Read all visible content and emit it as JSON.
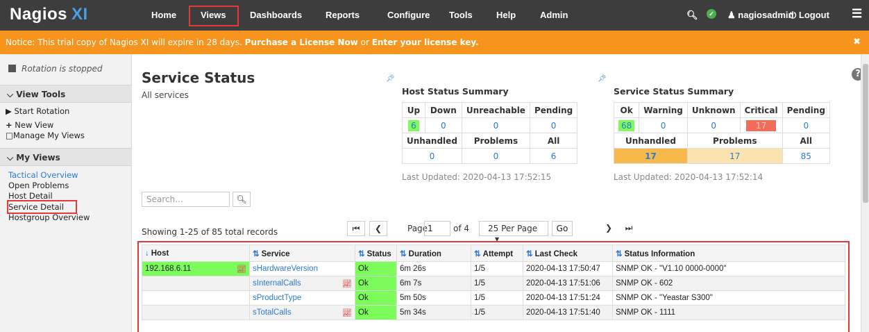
{
  "header": {
    "logo_main": "Nagios",
    "logo_sub": "XI",
    "nav": [
      "Home",
      "Views",
      "Dashboards",
      "Reports",
      "Configure",
      "Tools",
      "Help",
      "Admin"
    ],
    "user": "nagiosadmin",
    "logout": "Logout"
  },
  "notice": {
    "text": "Notice: This trial copy of Nagios XI will expire in 28 days.",
    "link1": "Purchase a License Now",
    "or": "or",
    "link2": "Enter your license key."
  },
  "sidebar": {
    "rotation": "Rotation is stopped",
    "view_tools": "View Tools",
    "start_rotation": "Start Rotation",
    "new_view": "New View",
    "manage_views": "Manage My Views",
    "my_views": "My Views",
    "views": [
      "Tactical Overview",
      "Open Problems",
      "Host Detail",
      "Service Detail",
      "Hostgroup Overview"
    ]
  },
  "main": {
    "title": "Service Status",
    "subtitle": "All services",
    "search_placeholder": "Search...",
    "showing": "Showing 1-25 of 85 total records",
    "page_label": "Page",
    "page_value": "1",
    "page_of": "of 4",
    "per_page": "25 Per Page",
    "go": "Go"
  },
  "host_summary": {
    "title": "Host Status Summary",
    "headers": [
      "Up",
      "Down",
      "Unreachable",
      "Pending"
    ],
    "values": [
      "6",
      "0",
      "0",
      "0"
    ],
    "headers2": [
      "Unhandled",
      "Problems",
      "All"
    ],
    "values2": [
      "0",
      "0",
      "6"
    ],
    "updated": "Last Updated: 2020-04-13 17:52:15"
  },
  "service_summary": {
    "title": "Service Status Summary",
    "headers": [
      "Ok",
      "Warning",
      "Unknown",
      "Critical",
      "Pending"
    ],
    "values": [
      "68",
      "0",
      "0",
      "17",
      "0"
    ],
    "headers2": [
      "Unhandled",
      "Problems",
      "All"
    ],
    "values2": [
      "17",
      "17",
      "85"
    ],
    "updated": "Last Updated: 2020-04-13 17:52:14"
  },
  "table": {
    "columns": [
      "Host",
      "Service",
      "Status",
      "Duration",
      "Attempt",
      "Last Check",
      "Status Information"
    ],
    "rows": [
      {
        "host": "192.168.6.11",
        "service": "sHardwareVersion",
        "status": "Ok",
        "duration": "6m 26s",
        "attempt": "1/5",
        "last_check": "2020-04-13 17:50:47",
        "info": "SNMP OK - \"V1.10 0000-0000\""
      },
      {
        "host": "",
        "service": "sInternalCalls",
        "status": "Ok",
        "duration": "6m 7s",
        "attempt": "1/5",
        "last_check": "2020-04-13 17:51:06",
        "info": "SNMP OK - 602"
      },
      {
        "host": "",
        "service": "sProductType",
        "status": "Ok",
        "duration": "5m 50s",
        "attempt": "1/5",
        "last_check": "2020-04-13 17:51:24",
        "info": "SNMP OK - \"Yeastar S300\""
      },
      {
        "host": "",
        "service": "sTotalCalls",
        "status": "Ok",
        "duration": "5m 34s",
        "attempt": "1/5",
        "last_check": "2020-04-13 17:51:40",
        "info": "SNMP OK - 1111"
      }
    ]
  },
  "colors": {
    "topbar": "#3d3d3d",
    "notice": "#f7941d",
    "ok": "#7cfc5a",
    "critical": "#f26c5a",
    "unhandled": "#f7b94c",
    "highlight": "#e53935",
    "link": "#2a7ad1"
  }
}
